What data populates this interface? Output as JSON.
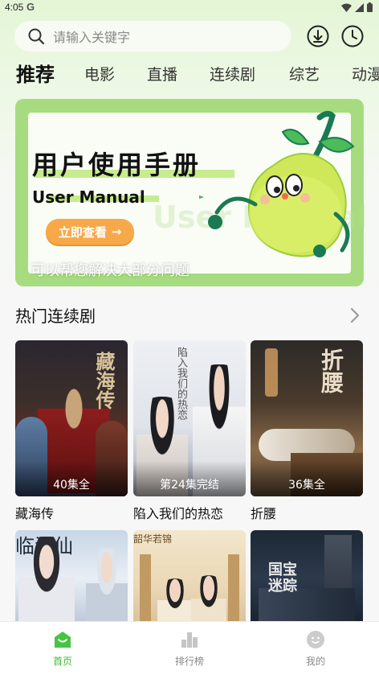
{
  "status_bar": {
    "time": "4:05",
    "carrier_glyph": "G"
  },
  "search": {
    "placeholder": "请输入关键字"
  },
  "tabs": [
    {
      "label": "推荐",
      "active": true
    },
    {
      "label": "电影",
      "active": false
    },
    {
      "label": "直播",
      "active": false
    },
    {
      "label": "连续剧",
      "active": false
    },
    {
      "label": "综艺",
      "active": false
    },
    {
      "label": "动漫",
      "active": false
    }
  ],
  "banner": {
    "title": "用户使用手册",
    "title_en": "User Manual",
    "watermark": "User Manual",
    "button_label": "立即查看",
    "button_arrow": "→",
    "subtitle": "可以帮您解决大部分问题"
  },
  "section": {
    "title": "热门连续剧",
    "more_icon": "chevron-right-icon"
  },
  "dramas": [
    {
      "title": "藏海传",
      "episodes": "40集全",
      "poster_text": "藏海传"
    },
    {
      "title": "陷入我们的热恋",
      "episodes": "第24集完结",
      "poster_text": "陷入我们的热恋"
    },
    {
      "title": "折腰",
      "episodes": "36集全",
      "poster_text": "折腰"
    }
  ],
  "dramas_row2": [
    {
      "poster_text": "临江仙"
    },
    {
      "poster_text": "韶华若锦"
    },
    {
      "poster_text": "国宝迷踪"
    }
  ],
  "bottom_nav": [
    {
      "label": "首页",
      "icon": "home-icon",
      "active": true
    },
    {
      "label": "排行榜",
      "icon": "ranking-icon",
      "active": false
    },
    {
      "label": "我的",
      "icon": "profile-icon",
      "active": false
    }
  ],
  "colors": {
    "accent": "#3bbf36",
    "banner_bg": "#a6dc7f",
    "button": "#f7a94a"
  }
}
